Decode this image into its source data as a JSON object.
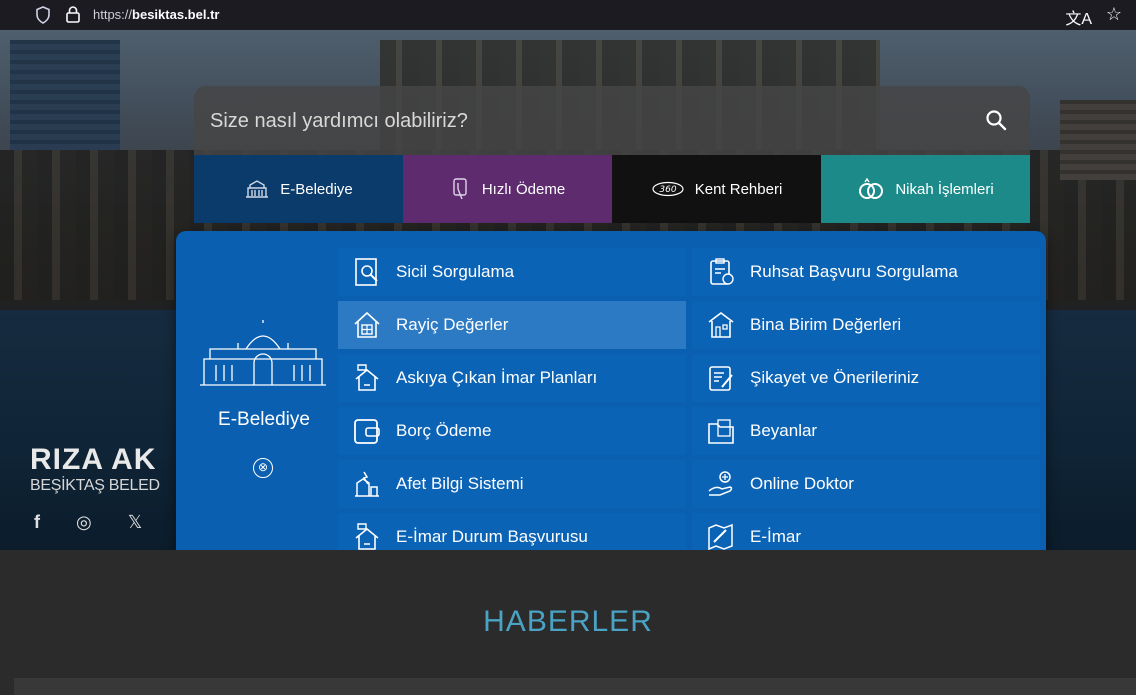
{
  "browser": {
    "url_prefix": "https://",
    "url_host": "besiktas.bel.tr",
    "icons": [
      "shield-icon",
      "lock-icon",
      "translate-icon",
      "bookmark-star-icon"
    ]
  },
  "search": {
    "placeholder": "Size nasıl yardımcı olabiliriz?"
  },
  "tabs": [
    {
      "label": "E-Belediye",
      "icon": "municipality-icon",
      "color": "#0b3b6a"
    },
    {
      "label": "Hızlı Ödeme",
      "icon": "card-tap-icon",
      "color": "#5d2b6e"
    },
    {
      "label": "Kent Rehberi",
      "icon": "360-icon",
      "color": "#111111"
    },
    {
      "label": "Nikah İşlemleri",
      "icon": "rings-icon",
      "color": "#1d8a8a"
    }
  ],
  "panel": {
    "title": "E-Belediye",
    "close": "⊗",
    "left_items": [
      {
        "label": "Sicil Sorgulama",
        "icon": "document-search-icon"
      },
      {
        "label": "Rayiç Değerler",
        "icon": "house-value-icon"
      },
      {
        "label": "Askıya Çıkan İmar Planları",
        "icon": "zoning-plan-icon"
      },
      {
        "label": "Borç Ödeme",
        "icon": "wallet-icon"
      },
      {
        "label": "Afet Bilgi Sistemi",
        "icon": "disaster-icon"
      },
      {
        "label": "E-İmar Durum Başvurusu",
        "icon": "zoning-status-icon"
      }
    ],
    "right_items": [
      {
        "label": "Ruhsat Başvuru Sorgulama",
        "icon": "license-clipboard-icon"
      },
      {
        "label": "Bina Birim Değerleri",
        "icon": "building-value-icon"
      },
      {
        "label": "Şikayet ve Önerileriniz",
        "icon": "feedback-edit-icon"
      },
      {
        "label": "Beyanlar",
        "icon": "declaration-folder-icon"
      },
      {
        "label": "Online Doktor",
        "icon": "doctor-hand-icon"
      },
      {
        "label": "E-İmar",
        "icon": "e-zoning-icon"
      }
    ]
  },
  "mayor": {
    "name": "RIZA AK",
    "role": "BEŞİKTAŞ BELED"
  },
  "social": [
    "f",
    "◎",
    "𝕏"
  ],
  "news": {
    "heading": "HABERLER"
  }
}
